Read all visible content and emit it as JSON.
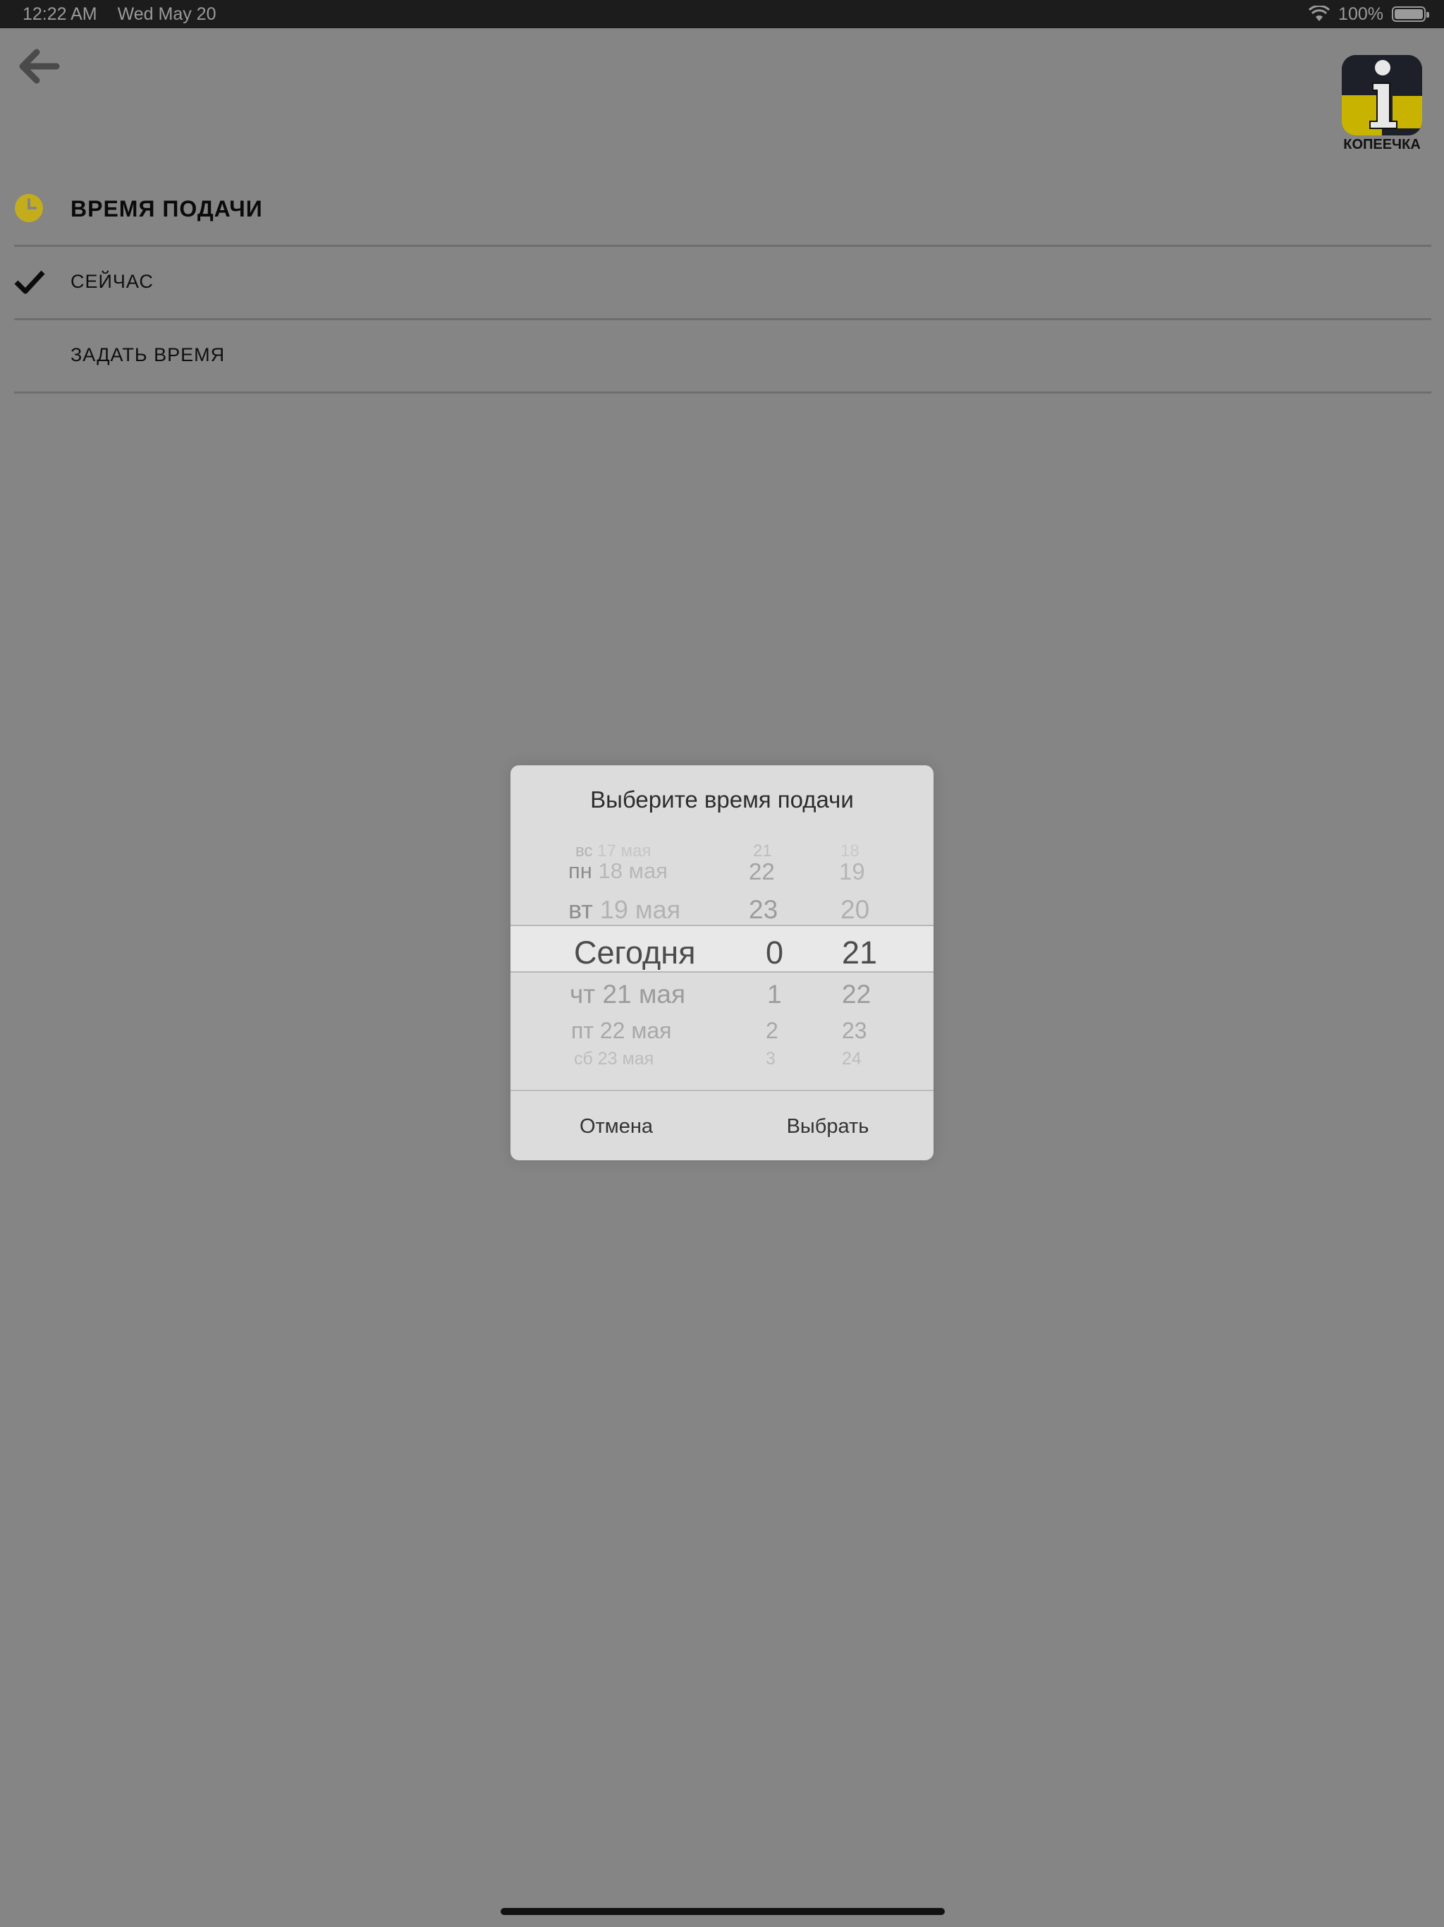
{
  "status_bar": {
    "time": "12:22 AM",
    "date": "Wed May 20",
    "battery": "100%",
    "wifi_icon": "wifi-icon",
    "battery_icon": "battery-icon"
  },
  "header": {
    "back_icon": "arrow-left-icon",
    "logo_text": "КОПЕЕЧКА",
    "logo_colors": {
      "yellow": "#c8b400",
      "dark": "#1d2029"
    }
  },
  "section": {
    "title": "ВРЕМЯ ПОДАЧИ",
    "icon": "clock-icon",
    "accent_color": "#c4ad1c"
  },
  "options": [
    {
      "label": "СЕЙЧАС",
      "selected": true
    },
    {
      "label": "ЗАДАТЬ ВРЕМЯ",
      "selected": false
    }
  ],
  "dialog": {
    "title": "Выберите время подачи",
    "cancel_label": "Отмена",
    "select_label": "Выбрать",
    "picker": {
      "days": [
        {
          "prefix": "вс",
          "rest": "17 мая"
        },
        {
          "prefix": "пн",
          "rest": "18 мая"
        },
        {
          "prefix": "вт",
          "rest": "19 мая"
        },
        {
          "prefix": "",
          "rest": "Сегодня"
        },
        {
          "prefix": "чт",
          "rest": "21 мая"
        },
        {
          "prefix": "пт",
          "rest": "22 мая"
        },
        {
          "prefix": "сб",
          "rest": "23 мая"
        }
      ],
      "hours": [
        "21",
        "22",
        "23",
        "0",
        "1",
        "2",
        "3"
      ],
      "minutes": [
        "18",
        "19",
        "20",
        "21",
        "22",
        "23",
        "24"
      ],
      "selected_index": 3
    }
  }
}
